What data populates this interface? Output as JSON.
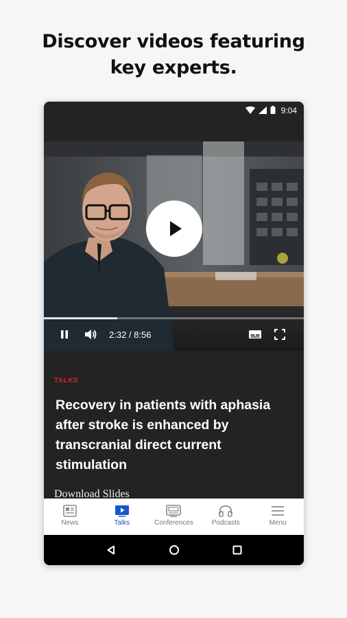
{
  "headline": {
    "line1": "Discover videos featuring",
    "line2": "key experts."
  },
  "status_bar": {
    "time": "9:04",
    "icons": [
      "wifi-icon",
      "signal-icon",
      "battery-icon"
    ]
  },
  "video": {
    "time_display": "2:32 / 8:56",
    "progress": 0.283,
    "controls": [
      "pause-icon",
      "volume-icon",
      "captions-icon",
      "fullscreen-icon"
    ]
  },
  "talk": {
    "category": "TALKS",
    "title": "Recovery in patients with aphasia after stroke is enhanced by transcranial direct current stimulation",
    "download_label": "Download Slides"
  },
  "tabs": [
    {
      "label": "News",
      "icon": "news-icon",
      "active": false
    },
    {
      "label": "Talks",
      "icon": "talks-icon",
      "active": true
    },
    {
      "label": "Conferences",
      "icon": "conferences-icon",
      "active": false
    },
    {
      "label": "Podcasts",
      "icon": "headphones-icon",
      "active": false
    },
    {
      "label": "Menu",
      "icon": "hamburger-icon",
      "active": false
    }
  ],
  "colors": {
    "accent": "#1a56c9",
    "tag_red": "#d1262c",
    "dark_bg": "#232323"
  }
}
